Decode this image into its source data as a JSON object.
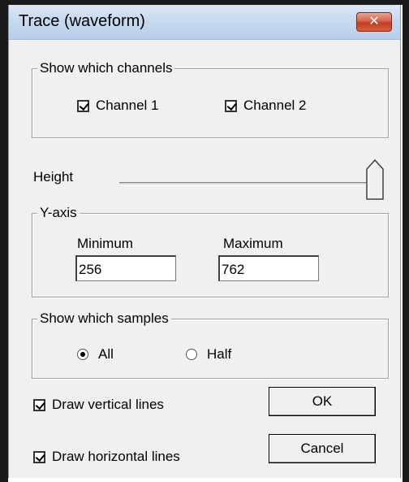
{
  "window": {
    "title": "Trace (waveform)",
    "close_glyph": "✕"
  },
  "channels": {
    "legend": "Show which channels",
    "channel1": {
      "label": "Channel 1",
      "checked": true
    },
    "channel2": {
      "label": "Channel 2",
      "checked": true
    }
  },
  "height": {
    "label": "Height",
    "value": 1.0
  },
  "yaxis": {
    "legend": "Y-axis",
    "min_label": "Minimum",
    "min_value": "256",
    "max_label": "Maximum",
    "max_value": "762"
  },
  "samples": {
    "legend": "Show which samples",
    "all_label": "All",
    "half_label": "Half",
    "selected": "All"
  },
  "options": {
    "vertical_lines": {
      "label": "Draw vertical lines",
      "checked": true
    },
    "horizontal_lines": {
      "label": "Draw horizontal lines",
      "checked": true
    }
  },
  "buttons": {
    "ok": "OK",
    "cancel": "Cancel"
  }
}
